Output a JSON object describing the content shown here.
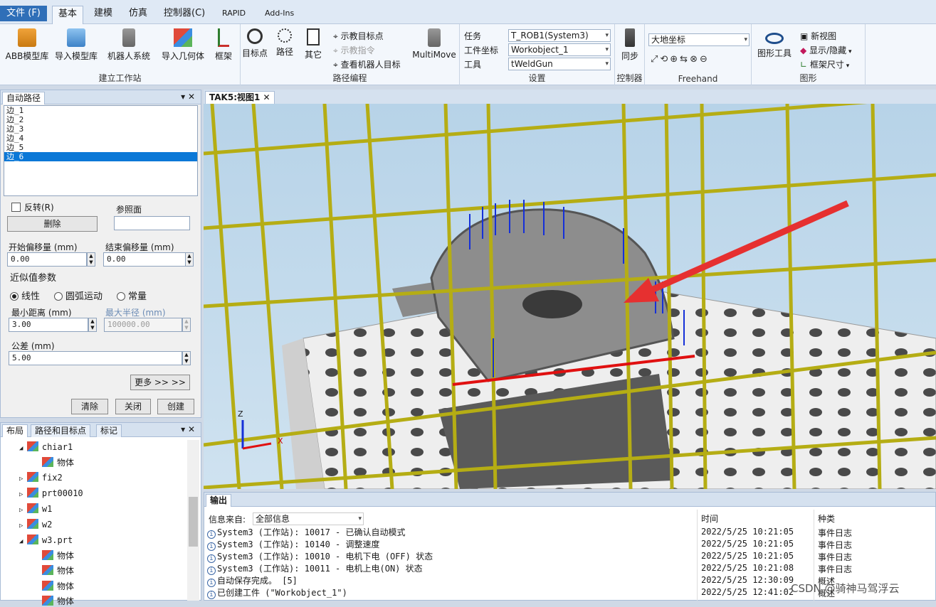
{
  "menu": {
    "file": "文件 (F)",
    "tabs": [
      "基本",
      "建模",
      "仿真",
      "控制器(C)",
      "RAPID",
      "Add-Ins"
    ]
  },
  "ribbon": {
    "build_station": {
      "name": "建立工作站",
      "buttons": [
        "ABB模型库",
        "导入模型库",
        "机器人系统",
        "导入几何体",
        "框架"
      ]
    },
    "path_programming": {
      "name": "路径编程",
      "buttons": [
        "目标点",
        "路径",
        "其它"
      ],
      "small": [
        "示教目标点",
        "示教指令",
        "查看机器人目标"
      ],
      "multimove": "MultiMove"
    },
    "settings": {
      "name": "设置",
      "task_label": "任务",
      "task_value": "T_ROB1(System3)",
      "wobj_label": "工件坐标",
      "wobj_value": "Workobject_1",
      "tool_label": "工具",
      "tool_value": "tWeldGun"
    },
    "controller": {
      "name": "控制器",
      "button": "同步"
    },
    "freehand": {
      "name": "Freehand",
      "combo": "大地坐标"
    },
    "graphics": {
      "name": "图形",
      "button": "图形工具",
      "small": [
        "新视图",
        "显示/隐藏",
        "框架尺寸"
      ]
    }
  },
  "autopath": {
    "title": "自动路径",
    "edges": [
      "边_1",
      "边_2",
      "边_3",
      "边_4",
      "边_5",
      "边_6"
    ],
    "selected_index": 5,
    "reverse_label": "反转(R)",
    "ref_label": "参照面",
    "delete_label": "删除",
    "start_offset_label": "开始偏移量 (mm)",
    "start_offset": "0.00",
    "end_offset_label": "结束偏移量 (mm)",
    "end_offset": "0.00",
    "approx_label": "近似值参数",
    "radio_linear": "线性",
    "radio_arc": "圆弧运动",
    "radio_const": "常量",
    "min_dist_label": "最小距离 (mm)",
    "min_dist": "3.00",
    "max_radius_label": "最大半径 (mm)",
    "max_radius": "100000.00",
    "tolerance_label": "公差 (mm)",
    "tolerance": "5.00",
    "more_label": "更多 >> >>",
    "clear_label": "清除",
    "close_label": "关闭",
    "create_label": "创建"
  },
  "layout": {
    "tabs": [
      "布局",
      "路径和目标点",
      "标记"
    ],
    "tree": [
      {
        "label": "chiar1",
        "expanded": true,
        "level": 0
      },
      {
        "label": "物体",
        "level": 1
      },
      {
        "label": "fix2",
        "expanded": false,
        "level": 0
      },
      {
        "label": "prt00010",
        "expanded": false,
        "level": 0
      },
      {
        "label": "w1",
        "expanded": false,
        "level": 0
      },
      {
        "label": "w2",
        "expanded": false,
        "level": 0
      },
      {
        "label": "w3.prt",
        "expanded": true,
        "level": 0
      },
      {
        "label": "物体",
        "level": 1
      },
      {
        "label": "物体",
        "level": 1
      },
      {
        "label": "物体",
        "level": 1
      },
      {
        "label": "物体",
        "level": 1
      }
    ]
  },
  "viewport": {
    "tab": "TAK5:视图1",
    "axis_x": "X",
    "axis_z": "Z"
  },
  "output": {
    "tab": "输出",
    "source_label": "信息来自:",
    "source_value": "全部信息",
    "col_time": "时间",
    "col_type": "种类",
    "rows": [
      {
        "msg": "System3 (工作站): 10017 - 已确认自动模式",
        "time": "2022/5/25 10:21:05",
        "type": "事件日志"
      },
      {
        "msg": "System3 (工作站): 10140 - 调整速度",
        "time": "2022/5/25 10:21:05",
        "type": "事件日志"
      },
      {
        "msg": "System3 (工作站): 10010 - 电机下电 (OFF) 状态",
        "time": "2022/5/25 10:21:05",
        "type": "事件日志"
      },
      {
        "msg": "System3 (工作站): 10011 - 电机上电(ON) 状态",
        "time": "2022/5/25 10:21:08",
        "type": "事件日志"
      },
      {
        "msg": "自动保存完成。 [5]",
        "time": "2022/5/25 12:30:09",
        "type": "概述"
      },
      {
        "msg": "已创建工件 (\"Workobject_1\")",
        "time": "2022/5/25 12:41:02",
        "type": "概述"
      }
    ]
  },
  "watermark": "CSDN @骑神马驾浮云"
}
